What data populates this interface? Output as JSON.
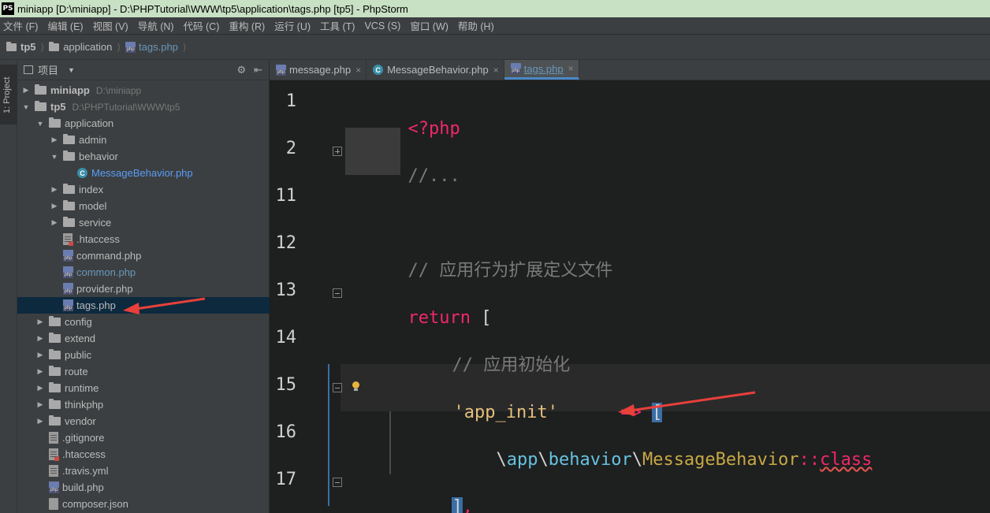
{
  "window": {
    "title": "miniapp [D:\\miniapp] - D:\\PHPTutorial\\WWW\\tp5\\application\\tags.php [tp5] - PhpStorm",
    "logo": "PS"
  },
  "menu": [
    "文件 (F)",
    "编辑 (E)",
    "视图 (V)",
    "导航 (N)",
    "代码 (C)",
    "重构 (R)",
    "运行 (U)",
    "工具 (T)",
    "VCS (S)",
    "窗口 (W)",
    "帮助 (H)"
  ],
  "breadcrumb": [
    "tp5",
    "application",
    "tags.php"
  ],
  "toolstrip": {
    "project_tab": "1: Project"
  },
  "project_panel": {
    "title": "项目",
    "tree": [
      {
        "label": "miniapp",
        "path": "D:\\miniapp",
        "level": 0,
        "arrow": "right",
        "icon": "folder",
        "bold": true
      },
      {
        "label": "tp5",
        "path": "D:\\PHPTutorial\\WWW\\tp5",
        "level": 0,
        "arrow": "down",
        "icon": "folder",
        "bold": true
      },
      {
        "label": "application",
        "level": 1,
        "arrow": "down",
        "icon": "folder"
      },
      {
        "label": "admin",
        "level": 2,
        "arrow": "right",
        "icon": "folder"
      },
      {
        "label": "behavior",
        "level": 2,
        "arrow": "down",
        "icon": "folder"
      },
      {
        "label": "MessageBehavior.php",
        "level": 3,
        "arrow": "none",
        "icon": "class",
        "style": "cyan"
      },
      {
        "label": "index",
        "level": 2,
        "arrow": "right",
        "icon": "folder"
      },
      {
        "label": "model",
        "level": 2,
        "arrow": "right",
        "icon": "folder"
      },
      {
        "label": "service",
        "level": 2,
        "arrow": "right",
        "icon": "folder"
      },
      {
        "label": ".htaccess",
        "level": 2,
        "arrow": "none",
        "icon": "plain-red"
      },
      {
        "label": "command.php",
        "level": 2,
        "arrow": "none",
        "icon": "php"
      },
      {
        "label": "common.php",
        "level": 2,
        "arrow": "none",
        "icon": "php",
        "style": "blue"
      },
      {
        "label": "provider.php",
        "level": 2,
        "arrow": "none",
        "icon": "php"
      },
      {
        "label": "tags.php",
        "level": 2,
        "arrow": "none",
        "icon": "php",
        "selected": true
      },
      {
        "label": "config",
        "level": 1,
        "arrow": "right",
        "icon": "folder"
      },
      {
        "label": "extend",
        "level": 1,
        "arrow": "right",
        "icon": "folder"
      },
      {
        "label": "public",
        "level": 1,
        "arrow": "right",
        "icon": "folder"
      },
      {
        "label": "route",
        "level": 1,
        "arrow": "right",
        "icon": "folder"
      },
      {
        "label": "runtime",
        "level": 1,
        "arrow": "right",
        "icon": "folder"
      },
      {
        "label": "thinkphp",
        "level": 1,
        "arrow": "right",
        "icon": "folder"
      },
      {
        "label": "vendor",
        "level": 1,
        "arrow": "right",
        "icon": "folder"
      },
      {
        "label": ".gitignore",
        "level": 1,
        "arrow": "none",
        "icon": "plain"
      },
      {
        "label": ".htaccess",
        "level": 1,
        "arrow": "none",
        "icon": "plain-red"
      },
      {
        "label": ".travis.yml",
        "level": 1,
        "arrow": "none",
        "icon": "plain"
      },
      {
        "label": "build.php",
        "level": 1,
        "arrow": "none",
        "icon": "php"
      },
      {
        "label": "composer.json",
        "level": 1,
        "arrow": "none",
        "icon": "json"
      }
    ]
  },
  "tabs": [
    {
      "label": "message.php",
      "icon": "php",
      "active": false
    },
    {
      "label": "MessageBehavior.php",
      "icon": "class",
      "active": false
    },
    {
      "label": "tags.php",
      "icon": "php",
      "active": true
    }
  ],
  "editor": {
    "line_numbers": [
      "1",
      "2",
      "11",
      "12",
      "13",
      "14",
      "15",
      "16",
      "17"
    ],
    "code": {
      "l1": "<?php",
      "l2": "//...",
      "l12": "// 应用行为扩展定义文件",
      "l13_kw": "return",
      "l13_br": " [",
      "l14": "// 应用初始化",
      "l15_key": "'app_init'",
      "l15_arrow": "=>",
      "l15_br": "[",
      "l16_sep1": "\\",
      "l16_ns1": "app",
      "l16_sep2": "\\",
      "l16_ns2": "behavior",
      "l16_sep3": "\\",
      "l16_cls": "MessageBehavior",
      "l16_op": "::",
      "l16_class": "class",
      "l17_br": "]",
      "l17_comma": ","
    }
  },
  "colors": {
    "keyword": "#f0286a",
    "string": "#e5c07b",
    "comment": "#7a7a7a",
    "namespace": "#66c2e0",
    "class_name": "#c7a846",
    "annotation_arrow": "#e8403a"
  }
}
